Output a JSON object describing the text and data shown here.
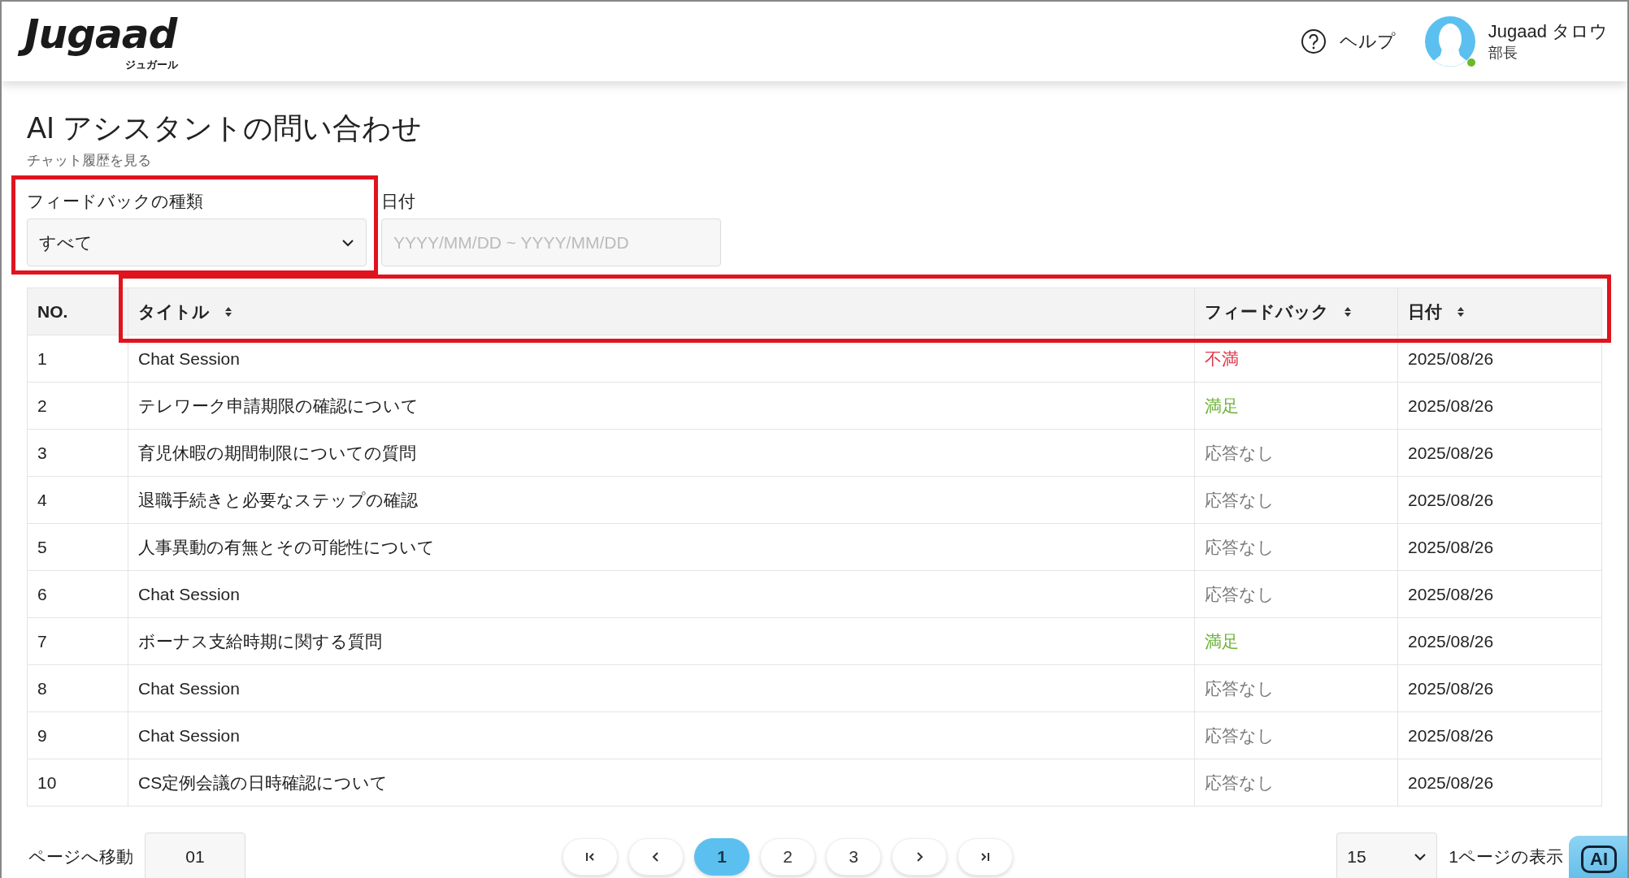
{
  "header": {
    "logo": {
      "wordmark": "Jugaad",
      "subtitle": "ジュガール"
    },
    "help": "ヘルプ",
    "user": {
      "name": "Jugaad タロウ",
      "role": "部長",
      "online": true
    }
  },
  "page": {
    "title": "AI アシスタントの問い合わせ",
    "subtitle": "チャット履歴を見る"
  },
  "filters": {
    "feedback_type": {
      "label": "フィードバックの種類",
      "value": "すべて",
      "highlighted": true
    },
    "date": {
      "label": "日付",
      "placeholder": "YYYY/MM/DD ~ YYYY/MM/DD"
    }
  },
  "table": {
    "header_highlighted": true,
    "columns": [
      {
        "label": "NO.",
        "sortable": false
      },
      {
        "label": "タイトル",
        "sortable": true
      },
      {
        "label": "フィードバック",
        "sortable": true
      },
      {
        "label": "日付",
        "sortable": true
      }
    ],
    "rows": [
      {
        "no": "1",
        "title": "Chat Session",
        "feedback": "不満",
        "kind": "negative",
        "date": "2025/08/26"
      },
      {
        "no": "2",
        "title": "テレワーク申請期限の確認について",
        "feedback": "満足",
        "kind": "positive",
        "date": "2025/08/26"
      },
      {
        "no": "3",
        "title": "育児休暇の期間制限についての質問",
        "feedback": "応答なし",
        "kind": "none",
        "date": "2025/08/26"
      },
      {
        "no": "4",
        "title": "退職手続きと必要なステップの確認",
        "feedback": "応答なし",
        "kind": "none",
        "date": "2025/08/26"
      },
      {
        "no": "5",
        "title": "人事異動の有無とその可能性について",
        "feedback": "応答なし",
        "kind": "none",
        "date": "2025/08/26"
      },
      {
        "no": "6",
        "title": "Chat Session",
        "feedback": "応答なし",
        "kind": "none",
        "date": "2025/08/26"
      },
      {
        "no": "7",
        "title": "ボーナス支給時期に関する質問",
        "feedback": "満足",
        "kind": "positive",
        "date": "2025/08/26"
      },
      {
        "no": "8",
        "title": "Chat Session",
        "feedback": "応答なし",
        "kind": "none",
        "date": "2025/08/26"
      },
      {
        "no": "9",
        "title": "Chat Session",
        "feedback": "応答なし",
        "kind": "none",
        "date": "2025/08/26"
      },
      {
        "no": "10",
        "title": "CS定例会議の日時確認について",
        "feedback": "応答なし",
        "kind": "none",
        "date": "2025/08/26"
      }
    ]
  },
  "pagination": {
    "jump_label": "ページへ移動",
    "jump_value": "01",
    "pages": [
      {
        "label": "1",
        "selected": true
      },
      {
        "label": "2",
        "selected": false
      },
      {
        "label": "3",
        "selected": false
      }
    ],
    "per_page": {
      "value": "15",
      "label": "1ページの表示"
    }
  },
  "ai_button": {
    "label": "AI"
  }
}
